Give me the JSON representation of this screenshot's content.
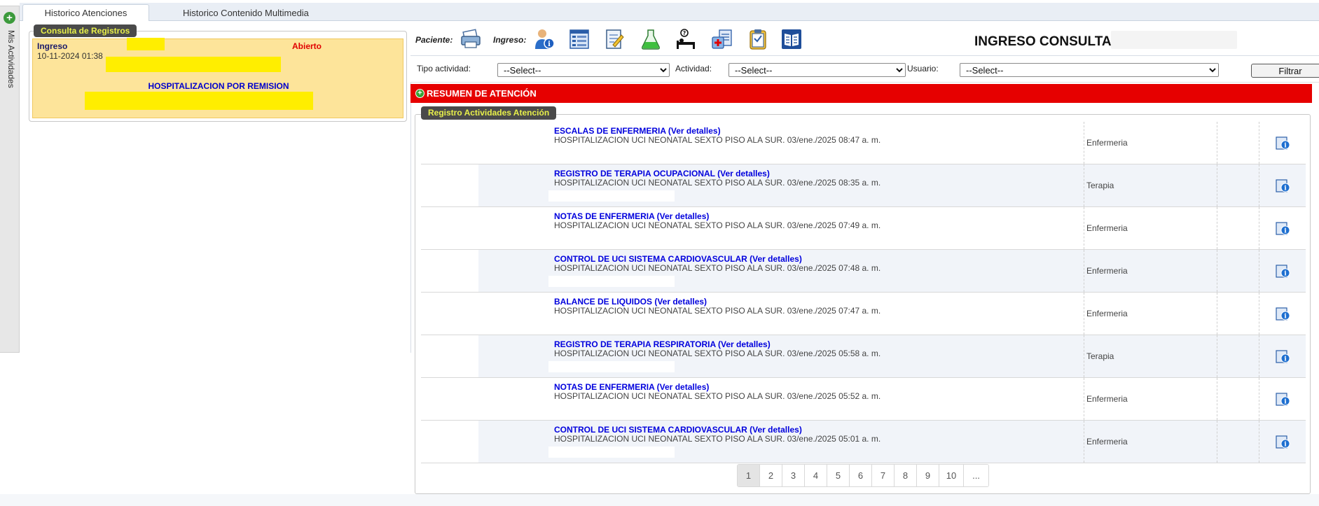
{
  "side_tab": {
    "label": "Mis Actividades"
  },
  "tabs": [
    {
      "label": "Historico Atenciones",
      "active": true
    },
    {
      "label": "Historico Contenido Multimedia",
      "active": false
    }
  ],
  "registros": {
    "legend": "Consulta de Registros",
    "card": {
      "label": "Ingreso",
      "date": "10-11-2024 01:38",
      "status": "Abierto",
      "type": "HOSPITALIZACION POR REMISION"
    }
  },
  "toolbar": {
    "paciente_label": "Paciente:",
    "ingreso_label": "Ingreso:",
    "ingreso_consultado": "INGRESO CONSULTADO:"
  },
  "filters": {
    "tipo_label": "Tipo actividad:",
    "tipo_value": "--Select--",
    "actividad_label": "Actividad:",
    "actividad_value": "--Select--",
    "usuario_label": "Usuario:",
    "usuario_value": "--Select--",
    "button": "Filtrar"
  },
  "resumen": {
    "label": "RESUMEN DE ATENCIÓN"
  },
  "actividades": {
    "legend": "Registro Actividades Atención",
    "rows": [
      {
        "title": "ESCALAS DE ENFERMERIA (Ver detalles)",
        "desc": "HOSPITALIZACION UCI NEONATAL SEXTO PISO ALA SUR. 03/ene./2025 08:47 a. m.",
        "category": "Enfermeria"
      },
      {
        "title": "REGISTRO DE TERAPIA OCUPACIONAL (Ver detalles)",
        "desc": "HOSPITALIZACION UCI NEONATAL SEXTO PISO ALA SUR. 03/ene./2025 08:35 a. m.",
        "category": "Terapia"
      },
      {
        "title": "NOTAS DE ENFERMERIA (Ver detalles)",
        "desc": "HOSPITALIZACION UCI NEONATAL SEXTO PISO ALA SUR. 03/ene./2025 07:49 a. m.",
        "category": "Enfermeria"
      },
      {
        "title": "CONTROL DE UCI SISTEMA CARDIOVASCULAR (Ver detalles)",
        "desc": "HOSPITALIZACION UCI NEONATAL SEXTO PISO ALA SUR. 03/ene./2025 07:48 a. m.",
        "category": "Enfermeria"
      },
      {
        "title": "BALANCE DE LIQUIDOS (Ver detalles)",
        "desc": "HOSPITALIZACION UCI NEONATAL SEXTO PISO ALA SUR. 03/ene./2025 07:47 a. m.",
        "category": "Enfermeria"
      },
      {
        "title": "REGISTRO DE TERAPIA RESPIRATORIA (Ver detalles)",
        "desc": "HOSPITALIZACION UCI NEONATAL SEXTO PISO ALA SUR. 03/ene./2025 05:58 a. m.",
        "category": "Terapia"
      },
      {
        "title": "NOTAS DE ENFERMERIA (Ver detalles)",
        "desc": "HOSPITALIZACION UCI NEONATAL SEXTO PISO ALA SUR. 03/ene./2025 05:52 a. m.",
        "category": "Enfermeria"
      },
      {
        "title": "CONTROL DE UCI SISTEMA CARDIOVASCULAR (Ver detalles)",
        "desc": "HOSPITALIZACION UCI NEONATAL SEXTO PISO ALA SUR. 03/ene./2025 05:01 a. m.",
        "category": "Enfermeria"
      }
    ]
  },
  "pagination": {
    "pages": [
      "1",
      "2",
      "3",
      "4",
      "5",
      "6",
      "7",
      "8",
      "9",
      "10",
      "..."
    ],
    "current": "1"
  },
  "colors": {
    "accent_red": "#e60000",
    "link_blue": "#0000dd",
    "card_bg": "#fde49a",
    "legend_text": "#e8f04a"
  }
}
